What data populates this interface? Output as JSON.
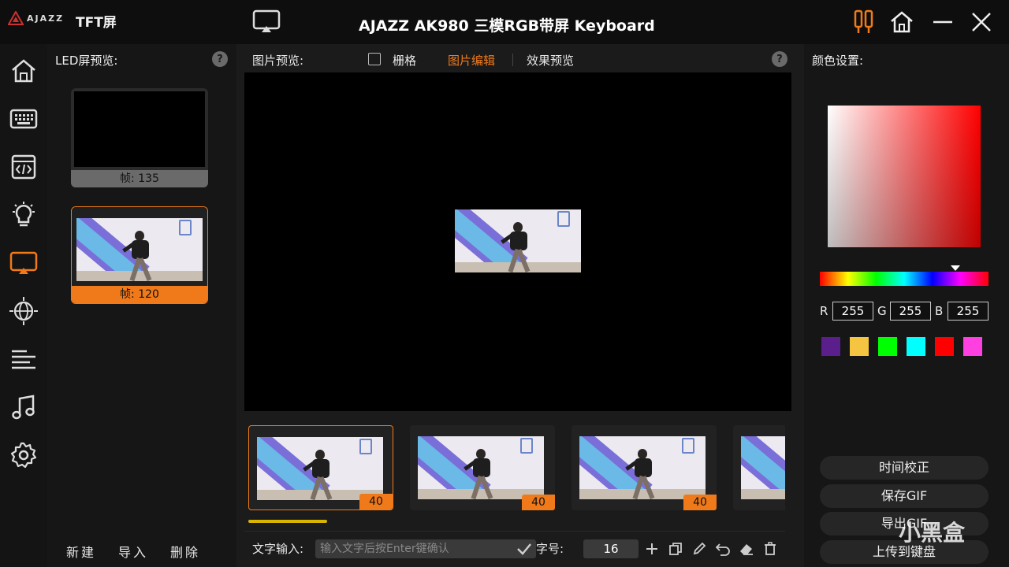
{
  "app": {
    "logo_text": "AJAZZ",
    "name": "TFT屏",
    "window_title": "AJAZZ AK980 三模RGB带屏 Keyboard"
  },
  "titlebar_buttons": [
    "settings-sliders-icon",
    "home-icon",
    "minimize-icon",
    "close-icon"
  ],
  "sidebar": {
    "items": [
      {
        "icon": "home-icon",
        "active": false
      },
      {
        "icon": "keyboard-icon",
        "active": false
      },
      {
        "icon": "code-window-icon",
        "active": false
      },
      {
        "icon": "light-bulb-icon",
        "active": false
      },
      {
        "icon": "screen-cast-icon",
        "active": true
      },
      {
        "icon": "globe-light-icon",
        "active": false
      },
      {
        "icon": "lines-icon",
        "active": false
      },
      {
        "icon": "music-note-icon",
        "active": false
      },
      {
        "icon": "gear-icon",
        "active": false
      }
    ]
  },
  "led_panel": {
    "title": "LED屏预览:",
    "help": "?",
    "frames": [
      {
        "label": "帧: 135",
        "selected": false
      },
      {
        "label": "帧: 120",
        "selected": true
      }
    ],
    "actions": {
      "new": "新建",
      "import": "导入",
      "delete": "删除"
    }
  },
  "center": {
    "preview_label": "图片预览:",
    "grid_label": "栅格",
    "grid_checked": false,
    "tab_edit": "图片编辑",
    "tab_effect": "效果预览",
    "active_tab": "图片编辑",
    "help": "?",
    "strip_frames": [
      {
        "duration": "40",
        "active": true
      },
      {
        "duration": "40",
        "active": false
      },
      {
        "duration": "40",
        "active": false
      }
    ],
    "text_input_label": "文字输入:",
    "text_input_placeholder": "输入文字后按Enter键确认",
    "font_size_label": "字号:",
    "font_size_value": "16"
  },
  "color_panel": {
    "title": "颜色设置:",
    "r_label": "R",
    "r_value": "255",
    "g_label": "G",
    "g_value": "255",
    "b_label": "B",
    "b_value": "255",
    "swatches": [
      "#5a1f8a",
      "#f5c542",
      "#00ff00",
      "#00ffff",
      "#ff0000",
      "#ff40e0"
    ],
    "buttons": {
      "time_correct": "时间校正",
      "save_gif": "保存GIF",
      "export_gif": "导出GIF",
      "upload": "上传到键盘"
    }
  },
  "colors": {
    "accent": "#f07a1a",
    "progress": "#d8b400"
  },
  "watermark": "小黑盒"
}
